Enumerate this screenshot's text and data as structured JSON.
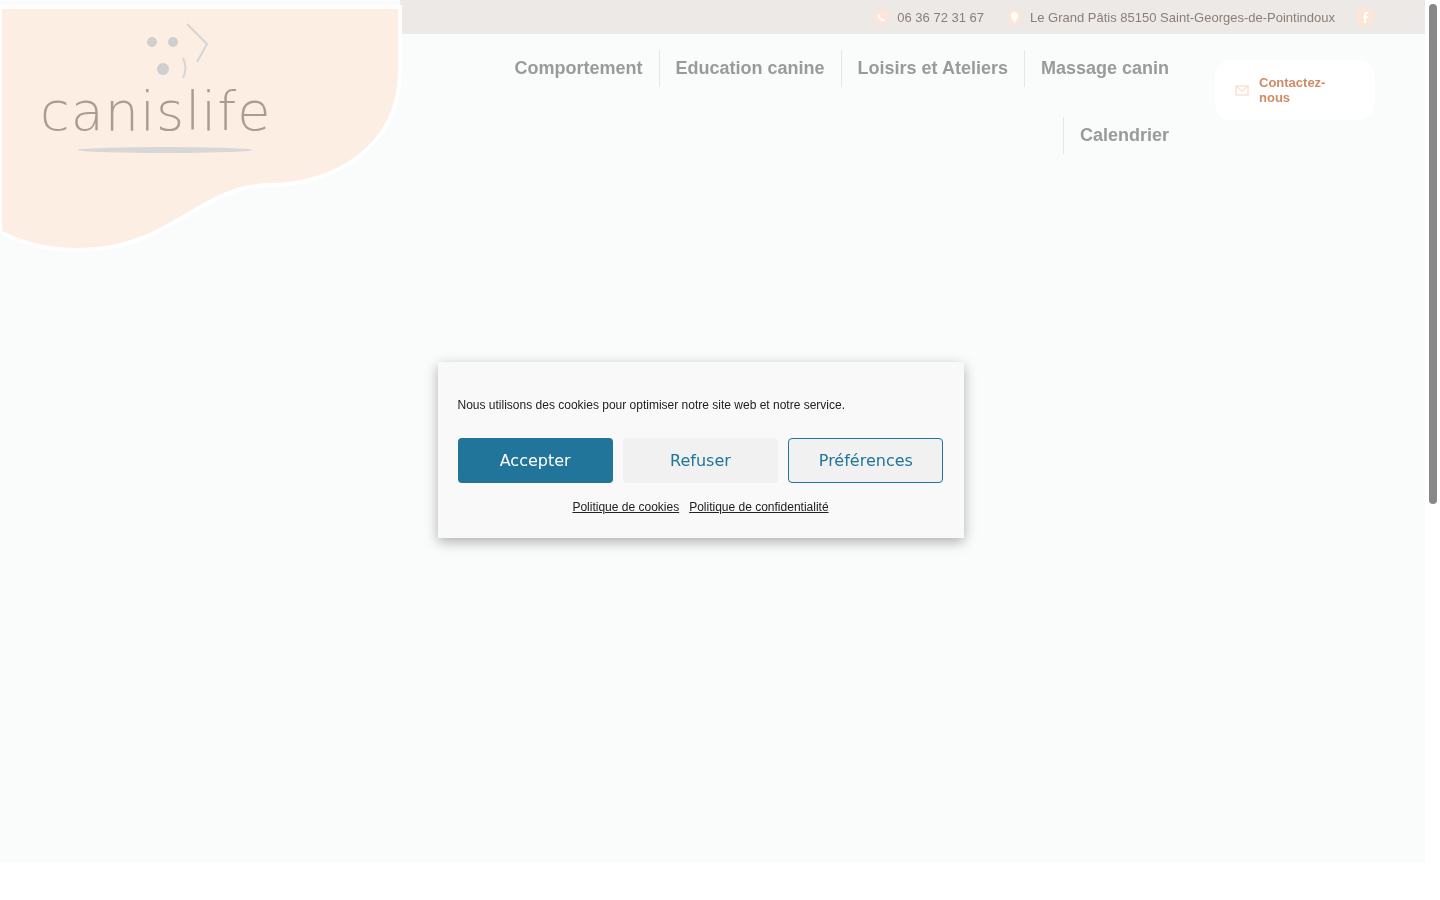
{
  "logo": {
    "text": "canislife"
  },
  "topbar": {
    "contacts": [
      {
        "kind": "phone",
        "text": "06 36 72 31 67"
      },
      {
        "kind": "location",
        "text": "Le Grand Pâtis 85150 Saint-Georges-de-Pointindoux"
      }
    ]
  },
  "nav": {
    "items": [
      "Comportement",
      "Education canine",
      "Loisirs et Ateliers",
      "Massage canin",
      "Calendrier"
    ],
    "contact_button": "Contactez-nous"
  },
  "cookie_dialog": {
    "message": "Nous utilisons des cookies pour optimiser notre site web et notre service.",
    "buttons": [
      {
        "kind": "primary",
        "label": "Accepter"
      },
      {
        "kind": "secondary",
        "label": "Refuser"
      },
      {
        "kind": "outline",
        "label": "Préférences"
      }
    ],
    "links": [
      "Politique de cookies",
      "Politique de confidentialité"
    ]
  }
}
